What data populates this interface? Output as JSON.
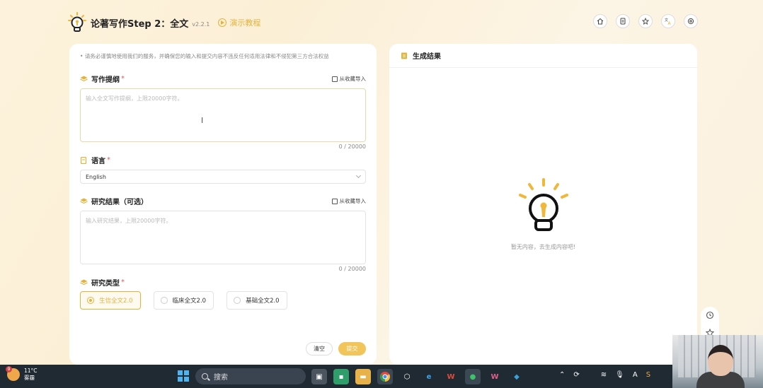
{
  "header": {
    "title": "论著写作Step 2：全文",
    "version": "v2.2.1",
    "demo_label": "演示教程",
    "icons": [
      "home-icon",
      "document-icon",
      "star-icon",
      "translate-icon",
      "settings-icon"
    ]
  },
  "left": {
    "notice": "请务必谨慎地使用我们的服务，并确保您的输入和提交内容不违反任何适用法律和不侵犯第三方合法权益",
    "outline": {
      "label": "写作提纲",
      "required": "*",
      "import_label": "从收藏导入",
      "placeholder": "输入全文写作提纲，上限20000字符。",
      "counter": "0 / 20000"
    },
    "language": {
      "label": "语言",
      "required": "*",
      "value": "English"
    },
    "results": {
      "label": "研究结果（可选）",
      "import_label": "从收藏导入",
      "placeholder": "输入研究结果，上限20000字符。",
      "counter": "0 / 20000"
    },
    "type": {
      "label": "研究类型",
      "required": "*",
      "options": [
        "生信全文2.0",
        "临床全文2.0",
        "基础全文2.0"
      ],
      "selected": 0
    },
    "buttons": {
      "clear": "清空",
      "submit": "提交"
    }
  },
  "right": {
    "title": "生成结果",
    "empty_text": "暂无内容，去生成内容吧!"
  },
  "taskbar": {
    "weather_temp": "11°C",
    "weather_desc": "雾霾",
    "weather_badge": "9",
    "search_label": "搜索"
  },
  "colors": {
    "accent": "#e3b33c",
    "accent_button": "#f2c55a",
    "background": "#fdf3dc",
    "taskbar": "#1f2a33"
  }
}
